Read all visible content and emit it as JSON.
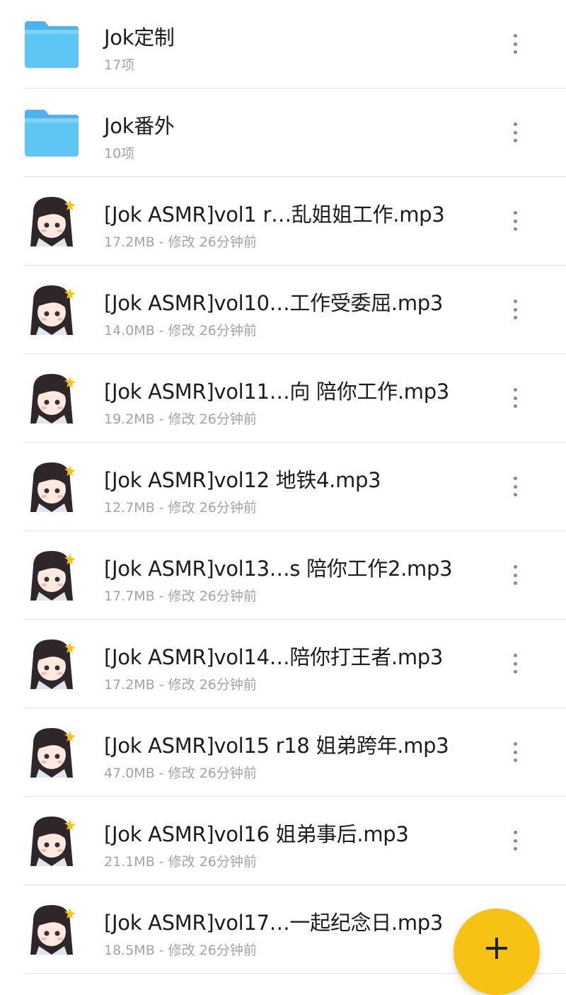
{
  "items": [
    {
      "type": "folder",
      "title": "Jok定制",
      "meta": "17项"
    },
    {
      "type": "folder",
      "title": "Jok番外",
      "meta": "10项"
    },
    {
      "type": "file",
      "title": "[Jok ASMR]vol1 r…乱姐姐工作.mp3",
      "meta": "17.2MB - 修改 26分钟前"
    },
    {
      "type": "file",
      "title": "[Jok ASMR]vol10…工作受委屈.mp3",
      "meta": "14.0MB - 修改 26分钟前"
    },
    {
      "type": "file",
      "title": "[Jok ASMR]vol11…向 陪你工作.mp3",
      "meta": "19.2MB - 修改 26分钟前"
    },
    {
      "type": "file",
      "title": "[Jok ASMR]vol12 地铁4.mp3",
      "meta": "12.7MB - 修改 26分钟前"
    },
    {
      "type": "file",
      "title": "[Jok ASMR]vol13…s 陪你工作2.mp3",
      "meta": "17.7MB - 修改 26分钟前"
    },
    {
      "type": "file",
      "title": "[Jok ASMR]vol14…陪你打王者.mp3",
      "meta": "17.2MB - 修改 26分钟前"
    },
    {
      "type": "file",
      "title": "[Jok ASMR]vol15 r18 姐弟跨年.mp3",
      "meta": "47.0MB - 修改 26分钟前"
    },
    {
      "type": "file",
      "title": "[Jok ASMR]vol16 姐弟事后.mp3",
      "meta": "21.1MB - 修改 26分钟前"
    },
    {
      "type": "file",
      "title": "[Jok ASMR]vol17…一起纪念日.mp3",
      "meta": "18.5MB - 修改 26分钟前"
    }
  ],
  "colors": {
    "folder": "#4fc3f7",
    "fab": "#f7c213",
    "divider": "#e3e3e3"
  },
  "icons": {
    "folder": "folder-icon",
    "file": "audio-cover-thumbnail",
    "more": "more-vertical-icon",
    "fab": "plus-icon"
  }
}
